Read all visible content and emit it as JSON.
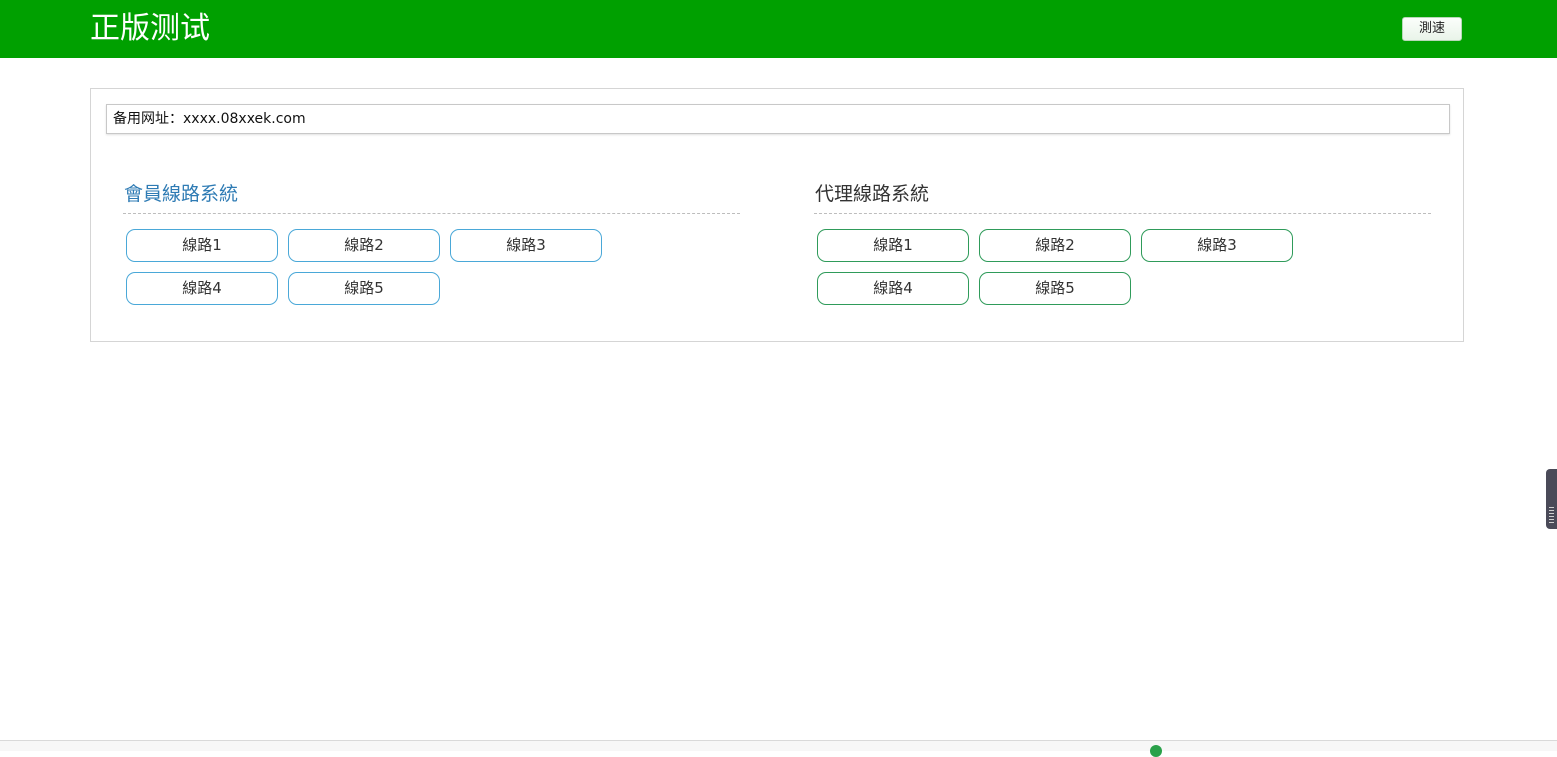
{
  "header": {
    "title": "正版测试",
    "speed_test_label": "測速"
  },
  "backup": {
    "text": "备用网址：xxxx.08xxek.com"
  },
  "member_system": {
    "title": "會員線路系統",
    "lines": [
      "線路1",
      "線路2",
      "線路3",
      "線路4",
      "線路5"
    ]
  },
  "agent_system": {
    "title": "代理線路系統",
    "lines": [
      "線路1",
      "線路2",
      "線路3",
      "線路4",
      "線路5"
    ]
  },
  "colors": {
    "header_bg": "#00a000",
    "member_accent": "#2e7bb4",
    "member_border": "#4aa8d8",
    "agent_border": "#2f9b5a"
  }
}
